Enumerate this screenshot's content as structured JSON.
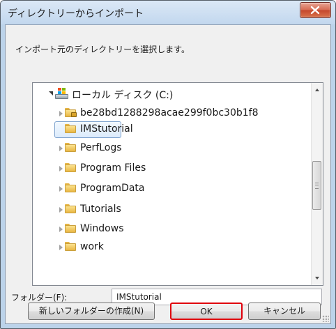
{
  "window": {
    "title": "ディレクトリーからインポート"
  },
  "instruction": "インポート元のディレクトリーを選択します。",
  "tree": {
    "items": [
      {
        "label": "ローカル ディスク (C:)",
        "icon": "drive-icon",
        "expander": "expanded"
      },
      {
        "label": "be28bd1288298acae299f0bc30b1f8",
        "icon": "locked-folder-icon",
        "expander": "collapsed"
      },
      {
        "label": "IMStutorial",
        "icon": "folder-icon",
        "expander": "none",
        "selected": true
      },
      {
        "label": "PerfLogs",
        "icon": "folder-icon",
        "expander": "collapsed"
      },
      {
        "label": "Program Files",
        "icon": "folder-icon",
        "expander": "collapsed"
      },
      {
        "label": "ProgramData",
        "icon": "folder-icon",
        "expander": "collapsed"
      },
      {
        "label": "Tutorials",
        "icon": "folder-icon",
        "expander": "collapsed"
      },
      {
        "label": "Windows",
        "icon": "folder-icon",
        "expander": "collapsed"
      },
      {
        "label": "work",
        "icon": "folder-icon",
        "expander": "collapsed"
      }
    ]
  },
  "folder_field": {
    "label": "フォルダー(F):",
    "value": "IMStutorial"
  },
  "buttons": {
    "new_folder": "新しいフォルダーの作成(N)",
    "ok": "OK",
    "cancel": "キャンセル"
  },
  "colors": {
    "highlight_border": "#e0000c",
    "selection_border": "#7da2ce",
    "titlebar": "#c2d7ee"
  }
}
